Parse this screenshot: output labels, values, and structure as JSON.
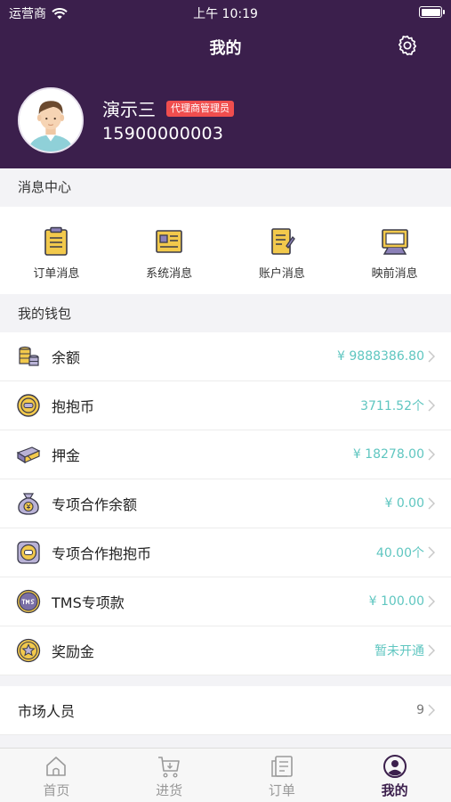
{
  "status_bar": {
    "carrier": "运营商",
    "time": "上午 10:19"
  },
  "nav": {
    "title": "我的"
  },
  "user": {
    "name": "演示三",
    "role": "代理商管理员",
    "phone": "15900000003"
  },
  "messages": {
    "title": "消息中心",
    "items": [
      {
        "label": "订单消息",
        "icon": "order-message-icon"
      },
      {
        "label": "系统消息",
        "icon": "system-message-icon"
      },
      {
        "label": "账户消息",
        "icon": "account-message-icon"
      },
      {
        "label": "映前消息",
        "icon": "pre-screening-message-icon"
      }
    ]
  },
  "wallet": {
    "title": "我的钱包",
    "items": [
      {
        "label": "余额",
        "value": "¥ 9888386.80",
        "icon": "coins-stack-icon"
      },
      {
        "label": "抱抱币",
        "value": "3711.52个",
        "icon": "coin-icon"
      },
      {
        "label": "押金",
        "value": "¥ 18278.00",
        "icon": "cash-bundle-icon"
      },
      {
        "label": "专项合作余额",
        "value": "¥ 0.00",
        "icon": "money-bag-icon"
      },
      {
        "label": "专项合作抱抱币",
        "value": "40.00个",
        "icon": "special-coin-icon"
      },
      {
        "label": "TMS专项款",
        "value": "¥ 100.00",
        "icon": "tms-coin-icon"
      },
      {
        "label": "奖励金",
        "value": "暂未开通",
        "icon": "star-medal-icon"
      }
    ]
  },
  "market": {
    "label": "市场人员",
    "value": "9"
  },
  "tabs": [
    {
      "label": "首页",
      "icon": "home-icon"
    },
    {
      "label": "进货",
      "icon": "cart-icon"
    },
    {
      "label": "订单",
      "icon": "order-list-icon"
    },
    {
      "label": "我的",
      "icon": "profile-icon",
      "active": true
    }
  ],
  "colors": {
    "header": "#3b1f4c",
    "accent_value": "#5fc6c0",
    "role_badge": "#f04e4e"
  }
}
